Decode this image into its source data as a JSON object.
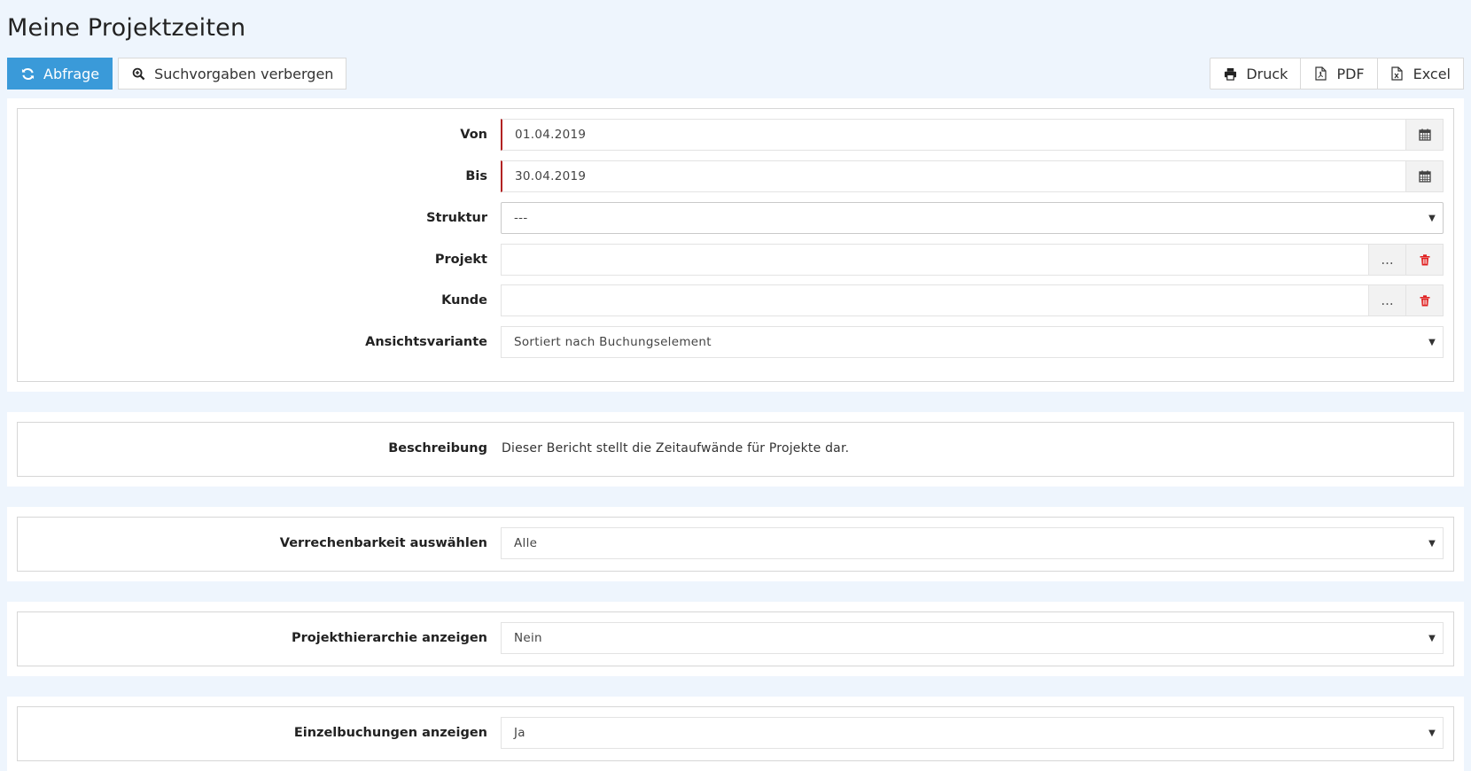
{
  "page": {
    "title": "Meine Projektzeiten"
  },
  "toolbar": {
    "query_label": "Abfrage",
    "toggle_search_label": "Suchvorgaben verbergen",
    "print_label": "Druck",
    "pdf_label": "PDF",
    "excel_label": "Excel"
  },
  "filters": {
    "von": {
      "label": "Von",
      "value": "01.04.2019"
    },
    "bis": {
      "label": "Bis",
      "value": "30.04.2019"
    },
    "struktur": {
      "label": "Struktur",
      "value": "---"
    },
    "projekt": {
      "label": "Projekt",
      "value": "",
      "lookup": "..."
    },
    "kunde": {
      "label": "Kunde",
      "value": "",
      "lookup": "..."
    },
    "ansicht": {
      "label": "Ansichtsvariante",
      "value": "Sortiert nach Buchungselement"
    }
  },
  "description": {
    "label": "Beschreibung",
    "text": "Dieser Bericht stellt die Zeitaufwände für Projekte dar."
  },
  "billing": {
    "label": "Verrechenbarkeit auswählen",
    "value": "Alle"
  },
  "hierarchy": {
    "label": "Projekthierarchie anzeigen",
    "value": "Nein"
  },
  "single": {
    "label": "Einzelbuchungen anzeigen",
    "value": "Ja"
  },
  "colors": {
    "primary": "#3a9ad9",
    "required_border": "#b22222",
    "delete": "#e02020",
    "background": "#eef5fd"
  }
}
